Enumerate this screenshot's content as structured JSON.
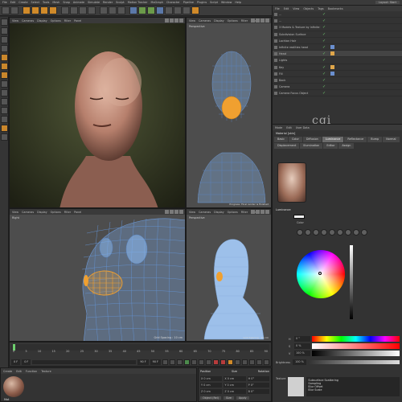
{
  "app": {
    "menu": [
      "File",
      "Edit",
      "Create",
      "Select",
      "Tools",
      "Mesh",
      "Snap",
      "Animate",
      "Simulate",
      "Render",
      "Sculpt",
      "Motion Tracker",
      "MoGraph",
      "Character",
      "Pipeline",
      "Plugins",
      "Script",
      "Window",
      "Help"
    ],
    "layout_label": "Layout",
    "layout_value": "Start"
  },
  "viewports": {
    "perspective_main": {
      "menu": [
        "View",
        "Cameras",
        "Display",
        "Options",
        "Filter",
        "Panel"
      ]
    },
    "front": {
      "menu": [
        "View",
        "Cameras",
        "Display",
        "Options",
        "Filter",
        "Panel"
      ],
      "label": "Perspective",
      "footer": "Progress: Final render is finished"
    },
    "right": {
      "menu": [
        "View",
        "Cameras",
        "Display",
        "Options",
        "Filter",
        "Panel"
      ],
      "label": "Right",
      "footer": "Grid Spacing : 10 cm"
    },
    "perspective_small": {
      "menu": [
        "View",
        "Cameras",
        "Display",
        "Options",
        "Filter",
        "Panel"
      ],
      "label": "Perspective",
      "footer": "Grid Spacing : 10 cm"
    }
  },
  "timeline": {
    "frames": [
      "0",
      "5",
      "10",
      "15",
      "20",
      "25",
      "30",
      "35",
      "40",
      "45",
      "50",
      "55",
      "60",
      "65",
      "70",
      "75",
      "80",
      "85",
      "90"
    ],
    "start_field": "0 F",
    "current_field": "0 F",
    "end_field": "90 F",
    "max_field": "90 F",
    "frame_indicator": "0 F"
  },
  "material_manager": {
    "menu": [
      "Create",
      "Edit",
      "Function",
      "Texture"
    ],
    "material_name": "Mat"
  },
  "coordinates": {
    "headers": [
      "Position",
      "Size",
      "Rotation"
    ],
    "rows": [
      [
        "X 0 cm",
        "X 0 cm",
        "H 0°"
      ],
      [
        "Y 0 cm",
        "Y 0 cm",
        "P 0°"
      ],
      [
        "Z 0 cm",
        "Z 0 cm",
        "B 0°"
      ]
    ],
    "mode": "Object (Rel)",
    "size_mode": "Size",
    "apply": "Apply"
  },
  "object_manager": {
    "menu": [
      "File",
      "Edit",
      "View",
      "Objects",
      "Tags",
      "Bookmarks"
    ],
    "rows": [
      {
        "name": "...",
        "selected": false,
        "tag": false
      },
      {
        "name": "...",
        "selected": false,
        "tag": false
      },
      {
        "name": "3 Models & Texture by Infinite Realities",
        "selected": false,
        "tag": false
      },
      {
        "name": "Subdivision Surface",
        "selected": false,
        "tag": false
      },
      {
        "name": "Lachlan Hair",
        "selected": false,
        "tag": false
      },
      {
        "name": "Infinite realities head",
        "selected": false,
        "tag": true
      },
      {
        "name": "Head",
        "selected": true,
        "tag": true
      },
      {
        "name": "Lights",
        "selected": false,
        "tag": false
      },
      {
        "name": "Key",
        "selected": false,
        "tag": true
      },
      {
        "name": "Fill",
        "selected": false,
        "tag": true
      },
      {
        "name": "Back",
        "selected": false,
        "tag": false
      },
      {
        "name": "Camera",
        "selected": false,
        "tag": false
      },
      {
        "name": "Camera Focus Object",
        "selected": false,
        "tag": false
      }
    ],
    "flag_symbol": "✓"
  },
  "attributes": {
    "menu": [
      "Mode",
      "Edit",
      "User Data"
    ],
    "title": "Material [skin]",
    "tabs": [
      "Basic",
      "Color",
      "Diffusion",
      "Luminance",
      "Reflectance",
      "Bump",
      "Normal",
      "Displacement",
      "Illumination",
      "Editor",
      "Assign"
    ],
    "active_tab": "Luminance",
    "section": "Luminance",
    "color_label": "Color",
    "hsv": [
      {
        "k": "H",
        "v": "0 °"
      },
      {
        "k": "S",
        "v": "0 %"
      },
      {
        "k": "V",
        "v": "100 %"
      }
    ],
    "brightness_label": "Brightness",
    "brightness_value": "100 %",
    "texture_label": "Texture",
    "texture_name": "Subsurface Scattering",
    "texture_params": [
      "Sampling",
      "Blur Offset",
      "Blur Scale"
    ]
  },
  "watermark": "cgi"
}
